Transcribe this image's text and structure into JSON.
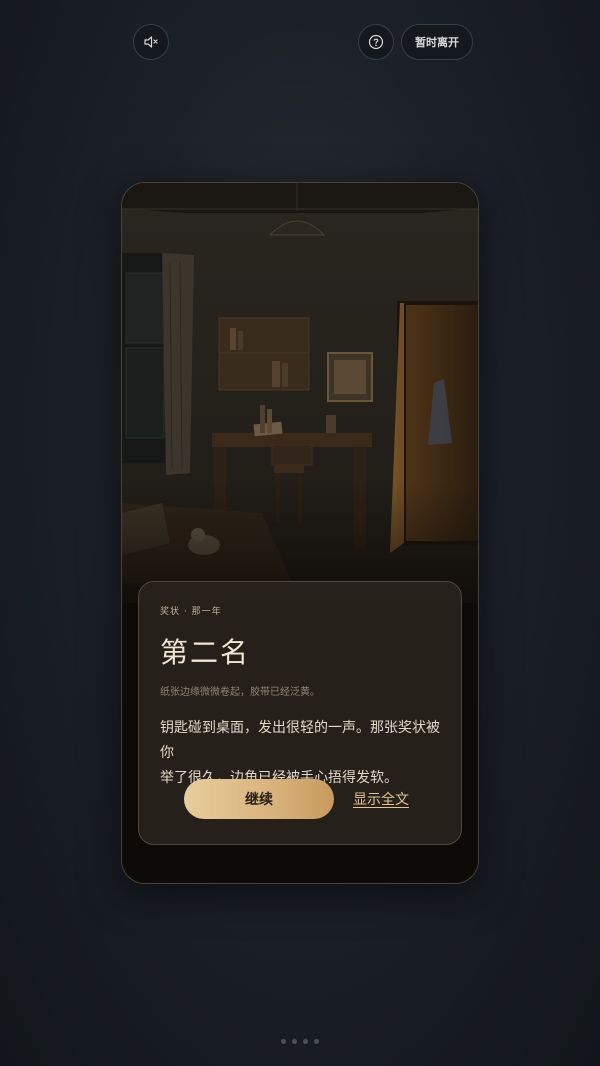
{
  "top_bar": {
    "mute_icon": "speaker-muted-icon",
    "help_icon": "question-circle-icon",
    "leave_label": "暂时离开"
  },
  "card": {
    "tag": "奖状 · 那一年",
    "title": "第二名",
    "subtitle": "纸张边缘微微卷起，胶带已经泛黄。",
    "body_line_1": "钥匙碰到桌面，发出很轻的一声。那张奖状被你",
    "body_line_2": "举了很久，边角已经被手心捂得发软。",
    "continue_label": "继续",
    "show_full_label": "显示全文"
  },
  "pagination": {
    "count": 4
  },
  "colors": {
    "accent_gold": "#d8b27c",
    "background": "#1c2128"
  }
}
